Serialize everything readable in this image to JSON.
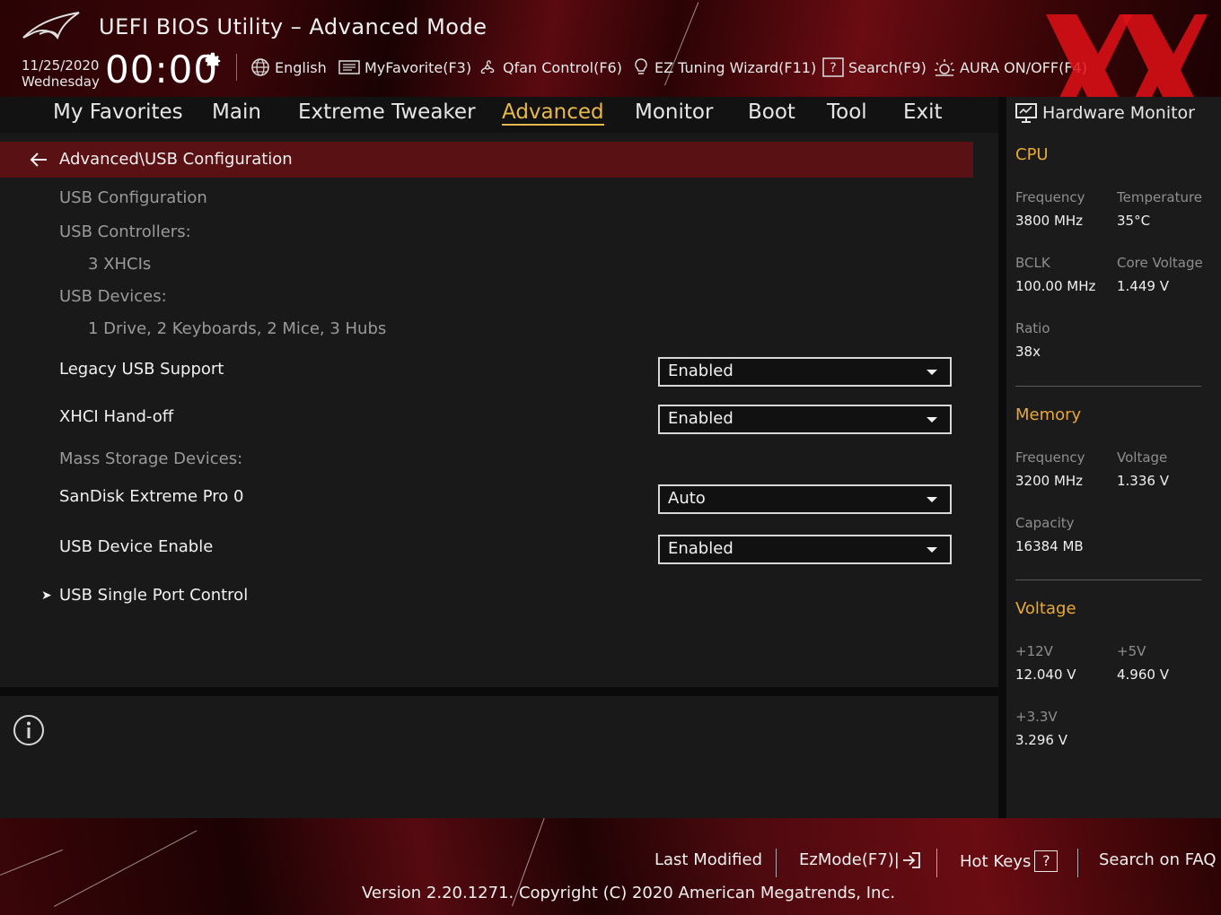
{
  "header": {
    "title": "UEFI BIOS Utility – Advanced Mode",
    "date": "11/25/2020",
    "weekday": "Wednesday",
    "time": "00:00",
    "tools": [
      {
        "label": "English",
        "icon": "globe-icon"
      },
      {
        "label": "MyFavorite(F3)",
        "icon": "favorite-icon"
      },
      {
        "label": "Qfan Control(F6)",
        "icon": "fan-icon"
      },
      {
        "label": "EZ Tuning Wizard(F11)",
        "icon": "lightbulb-icon"
      },
      {
        "label": "Search(F9)",
        "icon": "help-box-icon"
      },
      {
        "label": "AURA ON/OFF(F4)",
        "icon": "aura-icon"
      }
    ]
  },
  "nav": {
    "tabs": [
      "My Favorites",
      "Main",
      "Extreme Tweaker",
      "Advanced",
      "Monitor",
      "Boot",
      "Tool",
      "Exit"
    ],
    "active": "Advanced"
  },
  "breadcrumb": "Advanced\\USB Configuration",
  "settings": {
    "usb_configuration": "USB Configuration",
    "usb_controllers_label": "USB Controllers:",
    "usb_controllers_value": "3 XHCIs",
    "usb_devices_label": "USB Devices:",
    "usb_devices_value": "1 Drive, 2 Keyboards, 2 Mice, 3 Hubs",
    "legacy_usb_support": {
      "label": "Legacy USB Support",
      "value": "Enabled"
    },
    "xhci_handoff": {
      "label": "XHCI Hand-off",
      "value": "Enabled"
    },
    "mass_storage_label": "Mass Storage Devices:",
    "sandisk": {
      "label": "SanDisk Extreme Pro 0",
      "value": "Auto"
    },
    "usb_device_enable": {
      "label": "USB Device Enable",
      "value": "Enabled"
    },
    "usb_single_port_control": "USB Single Port Control"
  },
  "hardware_monitor": {
    "title": "Hardware Monitor",
    "cpu": {
      "title": "CPU",
      "frequency_label": "Frequency",
      "frequency": "3800 MHz",
      "temperature_label": "Temperature",
      "temperature": "35°C",
      "bclk_label": "BCLK",
      "bclk": "100.00 MHz",
      "core_voltage_label": "Core Voltage",
      "core_voltage": "1.449 V",
      "ratio_label": "Ratio",
      "ratio": "38x"
    },
    "memory": {
      "title": "Memory",
      "frequency_label": "Frequency",
      "frequency": "3200 MHz",
      "voltage_label": "Voltage",
      "voltage": "1.336 V",
      "capacity_label": "Capacity",
      "capacity": "16384 MB"
    },
    "voltage": {
      "title": "Voltage",
      "v12_label": "+12V",
      "v12": "12.040 V",
      "v5_label": "+5V",
      "v5": "4.960 V",
      "v33_label": "+3.3V",
      "v33": "3.296 V"
    }
  },
  "footer": {
    "last_modified": "Last Modified",
    "ezmode": "EzMode(F7)|",
    "hot_keys": "Hot Keys",
    "hot_keys_key": "?",
    "search_faq": "Search on FAQ",
    "version": "Version 2.20.1271. Copyright (C) 2020 American Megatrends, Inc."
  },
  "colors": {
    "accent": "#e8b84a",
    "section": "#e8a83a",
    "breadcrumb_bg": "#5a1113"
  }
}
